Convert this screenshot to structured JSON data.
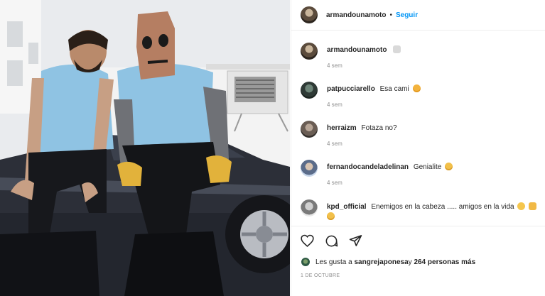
{
  "header": {
    "username": "armandounamoto",
    "separator": "•",
    "follow_label": "Seguir"
  },
  "comments": [
    {
      "user": "armandounamoto",
      "text": "",
      "emoji": "cat-face",
      "time": "4 sem"
    },
    {
      "user": "patpucciarello",
      "text": "Esa cami",
      "emoji": "heart-eyes-face",
      "time": "4 sem"
    },
    {
      "user": "herraizm",
      "text": "Fotaza no?",
      "emoji": "",
      "time": "4 sem"
    },
    {
      "user": "fernandocandeladelinan",
      "text": "Genialite",
      "emoji": "screaming-face",
      "time": "4 sem"
    },
    {
      "user": "kpd_official",
      "text": "Enemigos en la cabeza ..... amigos en la vida",
      "emoji": "sweat-smile-face, clapping-hands, screaming-face",
      "time": ""
    }
  ],
  "likes": {
    "prefix": "Les gusta a ",
    "first_user": "sangrejaponesa",
    "middle": " y ",
    "count_text": "264 personas más"
  },
  "post_date": "1 DE OCTUBRE",
  "icons": [
    "heart-icon",
    "comment-icon",
    "share-icon"
  ],
  "colors": {
    "accent": "#0095f6",
    "text": "#262626",
    "muted": "#8e8e8e"
  }
}
